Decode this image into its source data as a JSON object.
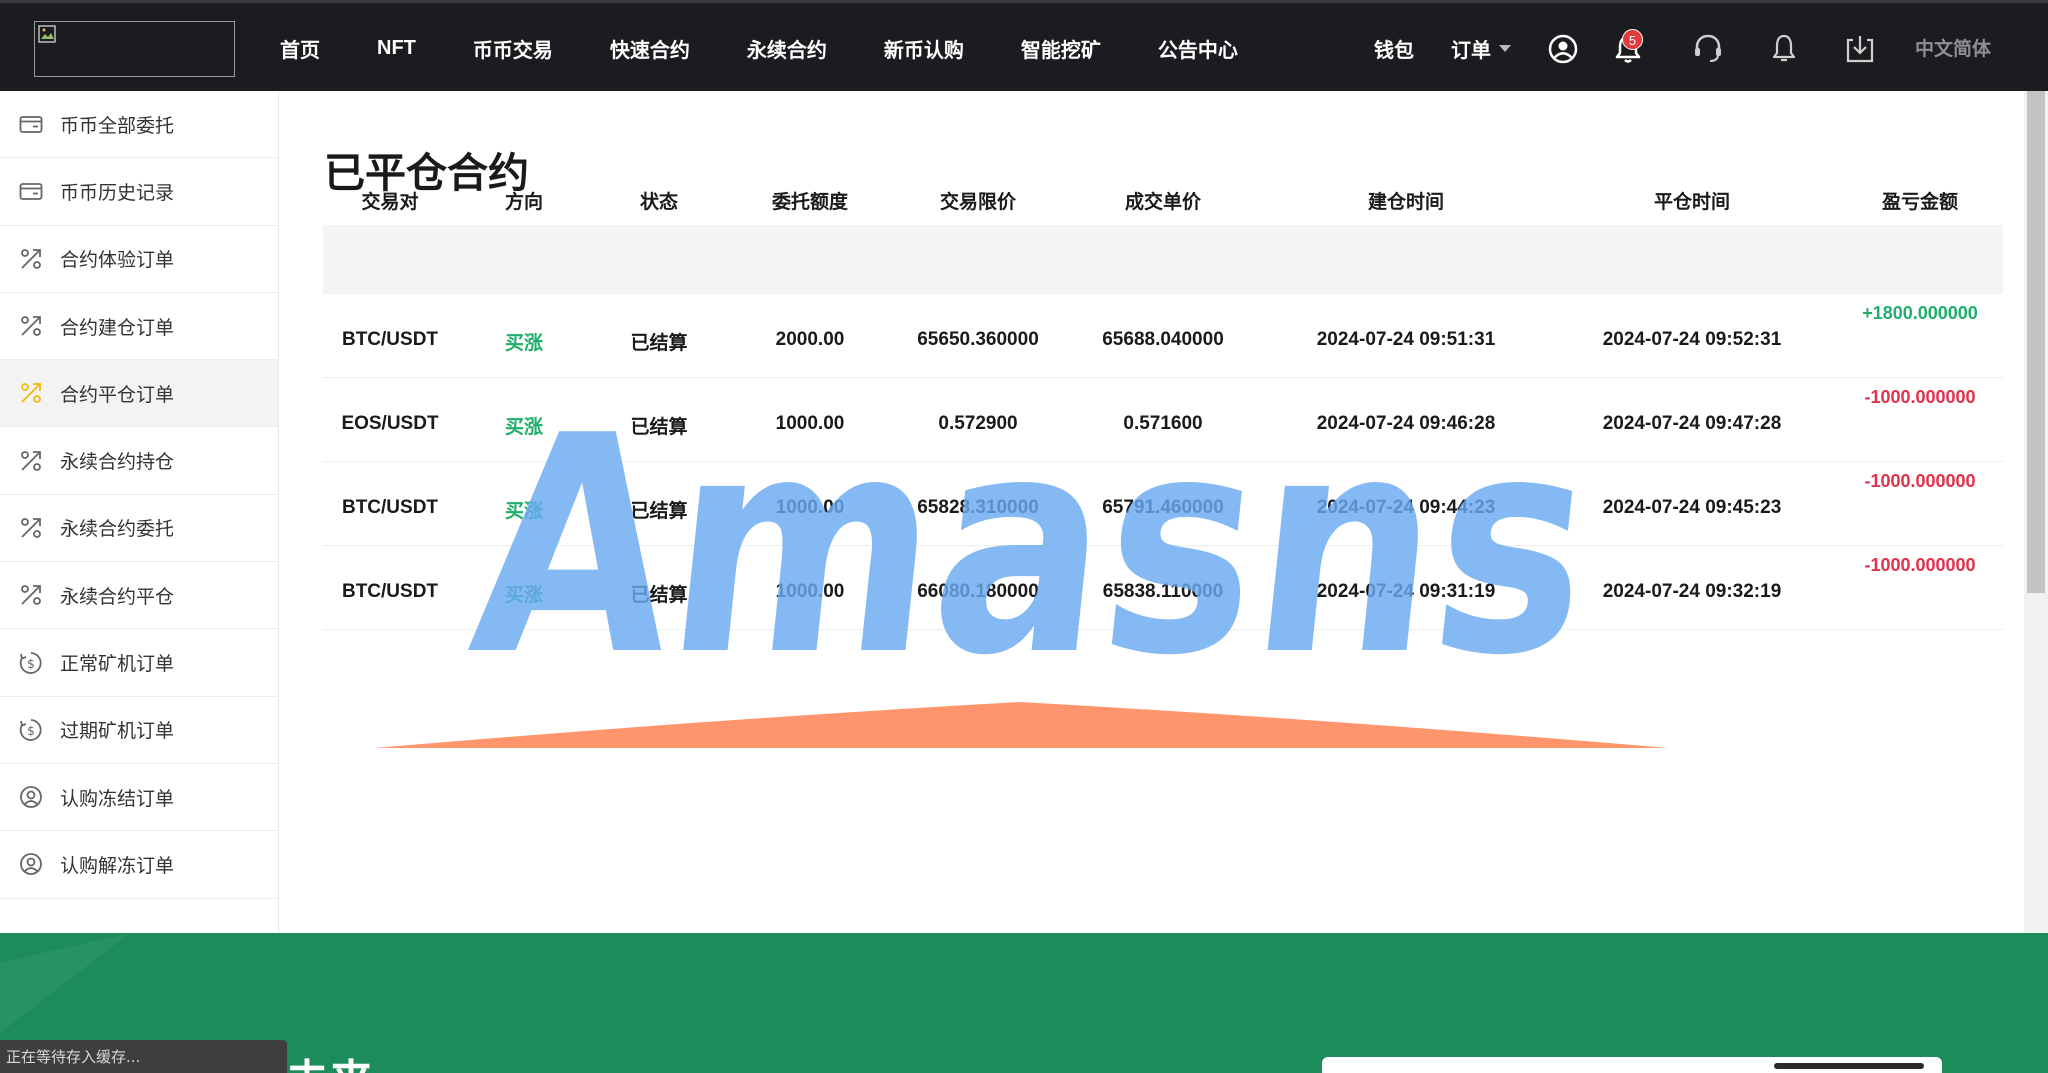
{
  "nav": {
    "items": [
      "首页",
      "NFT",
      "币币交易",
      "快速合约",
      "永续合约",
      "新币认购",
      "智能挖矿",
      "公告中心"
    ],
    "wallet": "钱包",
    "orders": "订单",
    "notification_count": "5",
    "language": "中文简体"
  },
  "sidebar": {
    "items": [
      {
        "label": "币币全部委托",
        "icon": "wallet-icon",
        "active": false
      },
      {
        "label": "币币历史记录",
        "icon": "wallet-icon",
        "active": false
      },
      {
        "label": "合约体验订单",
        "icon": "percent-icon",
        "active": false
      },
      {
        "label": "合约建仓订单",
        "icon": "percent-icon",
        "active": false
      },
      {
        "label": "合约平仓订单",
        "icon": "percent-icon",
        "active": true
      },
      {
        "label": "永续合约持仓",
        "icon": "percent-icon",
        "active": false
      },
      {
        "label": "永续合约委托",
        "icon": "percent-icon",
        "active": false
      },
      {
        "label": "永续合约平仓",
        "icon": "percent-icon",
        "active": false
      },
      {
        "label": "正常矿机订单",
        "icon": "dollar-cycle-icon",
        "active": false
      },
      {
        "label": "过期矿机订单",
        "icon": "dollar-cycle-icon",
        "active": false
      },
      {
        "label": "认购冻结订单",
        "icon": "user-coin-icon",
        "active": false
      },
      {
        "label": "认购解冻订单",
        "icon": "user-coin-icon",
        "active": false
      }
    ],
    "active_color": "#f0b90b"
  },
  "main": {
    "title": "已平仓合约",
    "columns": [
      "交易对",
      "方向",
      "状态",
      "委托额度",
      "交易限价",
      "成交单价",
      "建仓时间",
      "平仓时间",
      "盈亏金额"
    ],
    "rows": [
      {
        "pair": "BTC/USDT",
        "direction": "买涨",
        "status": "已结算",
        "amount": "2000.00",
        "limit_price": "65650.360000",
        "deal_price": "65688.040000",
        "open_time": "2024-07-24 09:51:31",
        "close_time": "2024-07-24 09:52:31",
        "pnl": "+1800.000000"
      },
      {
        "pair": "EOS/USDT",
        "direction": "买涨",
        "status": "已结算",
        "amount": "1000.00",
        "limit_price": "0.572900",
        "deal_price": "0.571600",
        "open_time": "2024-07-24 09:46:28",
        "close_time": "2024-07-24 09:47:28",
        "pnl": "-1000.000000"
      },
      {
        "pair": "BTC/USDT",
        "direction": "买涨",
        "status": "已结算",
        "amount": "1000.00",
        "limit_price": "65828.310000",
        "deal_price": "65791.460000",
        "open_time": "2024-07-24 09:44:23",
        "close_time": "2024-07-24 09:45:23",
        "pnl": "-1000.000000"
      },
      {
        "pair": "BTC/USDT",
        "direction": "买涨",
        "status": "已结算",
        "amount": "1000.00",
        "limit_price": "66080.180000",
        "deal_price": "65838.110000",
        "open_time": "2024-07-24 09:31:19",
        "close_time": "2024-07-24 09:32:19",
        "pnl": "-1000.000000"
      }
    ],
    "colors": {
      "up": "#1fae6b",
      "profit": "#1fae6b",
      "loss": "#e0324c"
    }
  },
  "watermark": {
    "text": "Amasns",
    "color": "#6aa9f0",
    "accent": "#ff8a5c"
  },
  "footer": {
    "heading": "未来",
    "status_text": "正在等待存入缓存..."
  }
}
